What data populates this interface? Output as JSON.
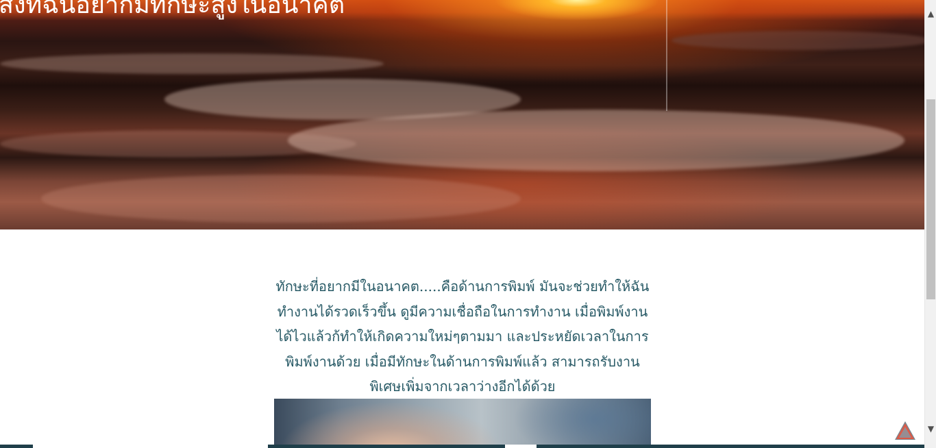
{
  "hero": {
    "title": "สิ่งที่ฉันอยากมีทักษะสูงในอนาคต"
  },
  "article": {
    "paragraph": "ทักษะที่อยากมีในอนาคต.....คือด้านการพิมพ์ มันจะช่วยทำให้ฉันทำงานได้รวดเร็วขึ้น ดูมีความเชื่อถือในการทำงาน เมื่อพิมพ์งานได้ไวแล้วก้ทำให้เกิดความใหม่ๆตามมา และประหยัดเวลาในการพิมพ์งานด้วย เมื่อมีทักษะในด้านการพิมพ์แล้ว สามารถรับงานพิเศษเพิ่มจากเวลาว่างอีกได้ด้วย"
  },
  "scrollbar": {
    "up_icon": "▲",
    "down_icon": "▼"
  },
  "colors": {
    "text": "#285a66",
    "bottom_bar": "#1f3f4a",
    "back_to_top": "#e8553f"
  },
  "icons": {
    "back_to_top": "triangle-up-icon"
  }
}
